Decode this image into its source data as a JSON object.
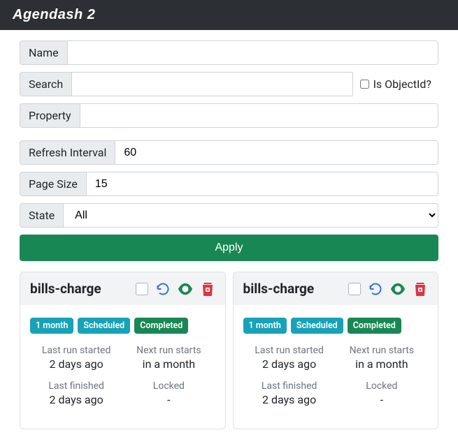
{
  "header": {
    "title": "Agendash 2"
  },
  "form": {
    "name": {
      "label": "Name",
      "value": ""
    },
    "search": {
      "label": "Search",
      "value": "",
      "isObjectIdLabel": "Is ObjectId?"
    },
    "property": {
      "label": "Property",
      "value": ""
    },
    "refreshInterval": {
      "label": "Refresh Interval",
      "value": "60"
    },
    "pageSize": {
      "label": "Page Size",
      "value": "15"
    },
    "state": {
      "label": "State",
      "selected": "All",
      "options": [
        "All"
      ]
    },
    "applyLabel": "Apply"
  },
  "cards": [
    {
      "title": "bills-charge",
      "badges": [
        {
          "text": "1 month",
          "variant": "info"
        },
        {
          "text": "Scheduled",
          "variant": "info"
        },
        {
          "text": "Completed",
          "variant": "success"
        }
      ],
      "stats": {
        "lastRunStarted": {
          "label": "Last run started",
          "value": "2 days ago"
        },
        "nextRunStarts": {
          "label": "Next run starts",
          "value": "in a month"
        },
        "lastFinished": {
          "label": "Last finished",
          "value": "2 days ago"
        },
        "locked": {
          "label": "Locked",
          "value": "-"
        }
      }
    },
    {
      "title": "bills-charge",
      "badges": [
        {
          "text": "1 month",
          "variant": "info"
        },
        {
          "text": "Scheduled",
          "variant": "info"
        },
        {
          "text": "Completed",
          "variant": "success"
        }
      ],
      "stats": {
        "lastRunStarted": {
          "label": "Last run started",
          "value": "2 days ago"
        },
        "nextRunStarts": {
          "label": "Next run starts",
          "value": "in a month"
        },
        "lastFinished": {
          "label": "Last finished",
          "value": "2 days ago"
        },
        "locked": {
          "label": "Locked",
          "value": "-"
        }
      }
    }
  ]
}
